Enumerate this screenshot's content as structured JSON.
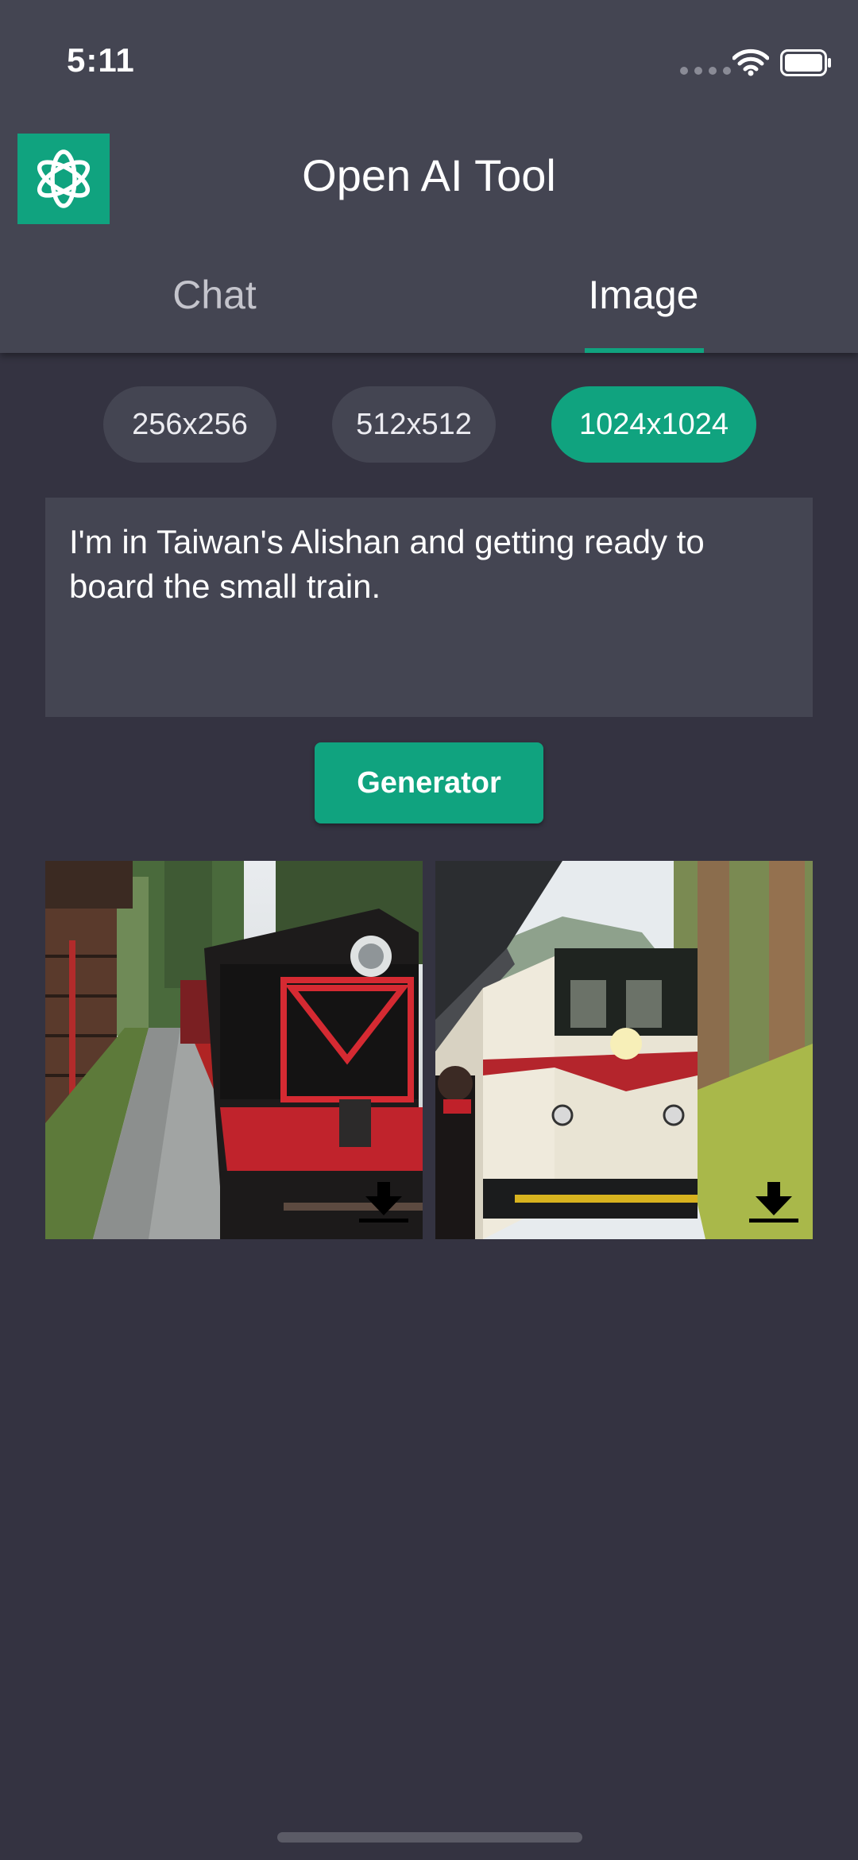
{
  "status_bar": {
    "time": "5:11"
  },
  "header": {
    "app_title": "Open AI Tool"
  },
  "tabs": [
    {
      "label": "Chat",
      "active": false
    },
    {
      "label": "Image",
      "active": true
    }
  ],
  "size_options": [
    {
      "label": "256x256",
      "selected": false
    },
    {
      "label": "512x512",
      "selected": false
    },
    {
      "label": "1024x1024",
      "selected": true
    }
  ],
  "prompt": {
    "value": "I'm in Taiwan's Alishan and getting ready to board the small train."
  },
  "generate_button": {
    "label": "Generator"
  },
  "generated_images": [
    {
      "subject": "black steam locomotive with red trim at forest station platform"
    },
    {
      "subject": "white and red diesel train with passenger on platform in forest"
    }
  ],
  "colors": {
    "accent": "#10a37f",
    "background": "#343341",
    "surface": "#444552",
    "tab_inactive": "#c4c4cc"
  },
  "icons": {
    "logo": "openai-logo-icon",
    "download": "download-icon",
    "wifi": "wifi-icon",
    "battery": "battery-icon"
  }
}
